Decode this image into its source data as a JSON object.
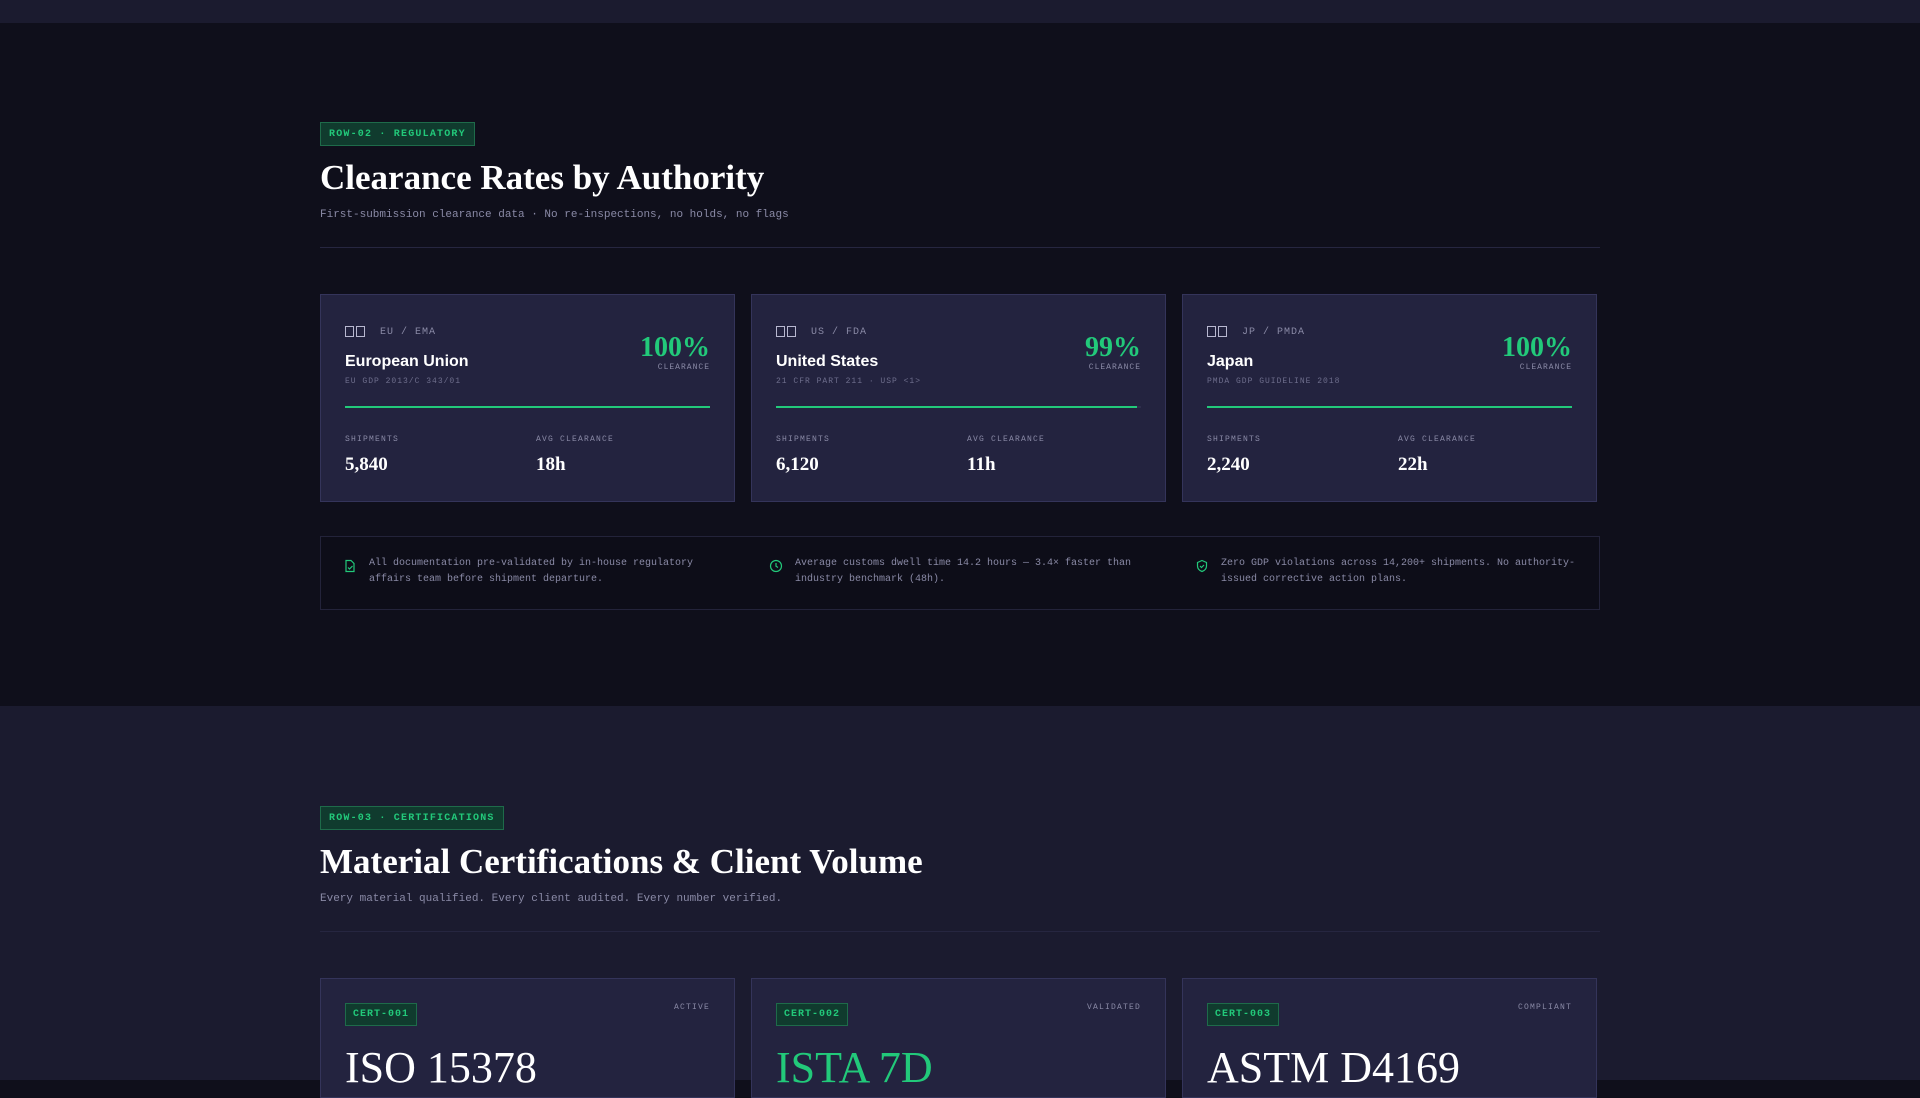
{
  "regulatory": {
    "tag": "ROW-02 · REGULATORY",
    "title": "Clearance Rates by Authority",
    "subtitle": "First-submission clearance data · No re-inspections, no holds, no flags",
    "cards": [
      {
        "authority": "EU / EMA",
        "name": "European Union",
        "regulation": "EU GDP 2013/C 343/01",
        "rate": "100%",
        "rate_label": "CLEARANCE",
        "rate_fraction": 1.0,
        "shipments_label": "SHIPMENTS",
        "shipments": "5,840",
        "avg_label": "AVG CLEARANCE",
        "avg": "18h"
      },
      {
        "authority": "US / FDA",
        "name": "United States",
        "regulation": "21 CFR PART 211 · USP <1>",
        "rate": "99%",
        "rate_label": "CLEARANCE",
        "rate_fraction": 0.99,
        "shipments_label": "SHIPMENTS",
        "shipments": "6,120",
        "avg_label": "AVG CLEARANCE",
        "avg": "11h"
      },
      {
        "authority": "JP / PMDA",
        "name": "Japan",
        "regulation": "PMDA GDP GUIDELINE 2018",
        "rate": "100%",
        "rate_label": "CLEARANCE",
        "rate_fraction": 1.0,
        "shipments_label": "SHIPMENTS",
        "shipments": "2,240",
        "avg_label": "AVG CLEARANCE",
        "avg": "22h"
      }
    ],
    "notes": [
      {
        "icon": "document-check-icon",
        "text": "All documentation pre-validated by in-house regulatory affairs team before shipment departure."
      },
      {
        "icon": "clock-icon",
        "text": "Average customs dwell time 14.2 hours — 3.4× faster than industry benchmark (48h)."
      },
      {
        "icon": "shield-check-icon",
        "text": "Zero GDP violations across 14,200+ shipments. No authority-issued corrective action plans."
      }
    ]
  },
  "certifications": {
    "tag": "ROW-03 · CERTIFICATIONS",
    "title": "Material Certifications & Client Volume",
    "subtitle": "Every material qualified. Every client audited. Every number verified.",
    "cards": [
      {
        "id": "CERT-001",
        "status": "ACTIVE",
        "name": "ISO 15378",
        "highlight": false
      },
      {
        "id": "CERT-002",
        "status": "VALIDATED",
        "name": "ISTA 7D",
        "highlight": true
      },
      {
        "id": "CERT-003",
        "status": "COMPLIANT",
        "name": "ASTM D4169",
        "highlight": false
      }
    ]
  },
  "colors": {
    "accent": "#22c97a",
    "background": "#0f0f1b",
    "card": "#23233f",
    "band": "#1b1b2f"
  }
}
